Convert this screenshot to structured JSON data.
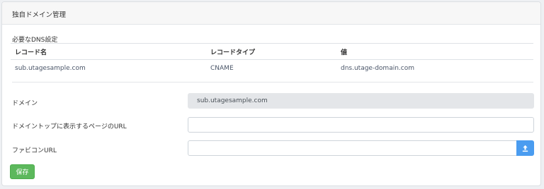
{
  "card": {
    "title": "独自ドメイン管理"
  },
  "dns": {
    "section_label": "必要なDNS設定",
    "headers": [
      "レコード名",
      "レコードタイプ",
      "値"
    ],
    "rows": [
      [
        "sub.utagesample.com",
        "CNAME",
        "dns.utage-domain.com"
      ]
    ]
  },
  "form": {
    "domain": {
      "label": "ドメイン",
      "value": "sub.utagesample.com"
    },
    "top_page_url": {
      "label": "ドメイントップに表示するページのURL",
      "value": ""
    },
    "favicon_url": {
      "label": "ファビコンURL",
      "value": "",
      "button_icon": "upload-icon"
    }
  },
  "actions": {
    "save_label": "保存"
  },
  "colors": {
    "save_button": "#5cb85c",
    "upload_button": "#4a9cf0",
    "readonly_field": "#e4e6e9"
  }
}
